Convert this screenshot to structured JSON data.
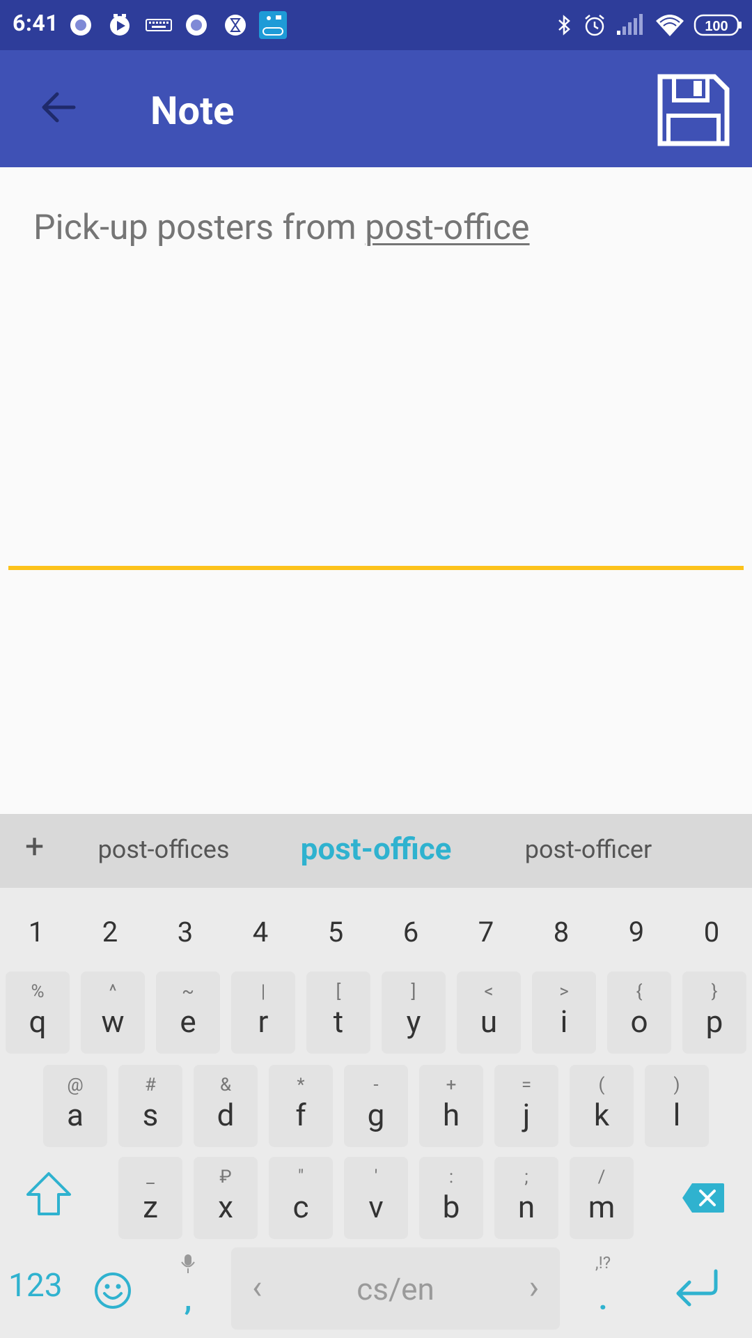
{
  "status_bar": {
    "time": "6:41",
    "battery": "100",
    "notification_icons": [
      "circle-notification-icon",
      "play-notification-icon",
      "keyboard-notification-icon",
      "circle-notification-icon",
      "hourglass-notification-icon",
      "fitness-app-notification-icon"
    ],
    "system_icons": [
      "bluetooth-icon",
      "alarm-icon",
      "signal-icon",
      "wifi-icon",
      "battery-icon"
    ]
  },
  "app_bar": {
    "title": "Note",
    "back_icon": "arrow-back-icon",
    "save_icon": "save-floppy-icon",
    "color": "#3f51b5",
    "status_color": "#2e3d9a"
  },
  "note": {
    "text_before": "Pick-up posters from ",
    "composing_word": "post-office",
    "underline_color": "#fcc21b"
  },
  "keyboard": {
    "suggestions": {
      "left": "post-offices",
      "center": "post-office",
      "right": "post-officer"
    },
    "number_row": [
      "1",
      "2",
      "3",
      "4",
      "5",
      "6",
      "7",
      "8",
      "9",
      "0"
    ],
    "row1": [
      {
        "key": "q",
        "alt": "%"
      },
      {
        "key": "w",
        "alt": "^"
      },
      {
        "key": "e",
        "alt": "~"
      },
      {
        "key": "r",
        "alt": "|"
      },
      {
        "key": "t",
        "alt": "["
      },
      {
        "key": "y",
        "alt": "]"
      },
      {
        "key": "u",
        "alt": "<"
      },
      {
        "key": "i",
        "alt": ">"
      },
      {
        "key": "o",
        "alt": "{"
      },
      {
        "key": "p",
        "alt": "}"
      }
    ],
    "row2": [
      {
        "key": "a",
        "alt": "@"
      },
      {
        "key": "s",
        "alt": "#"
      },
      {
        "key": "d",
        "alt": "&"
      },
      {
        "key": "f",
        "alt": "*"
      },
      {
        "key": "g",
        "alt": "-"
      },
      {
        "key": "h",
        "alt": "+"
      },
      {
        "key": "j",
        "alt": "="
      },
      {
        "key": "k",
        "alt": "("
      },
      {
        "key": "l",
        "alt": ")"
      }
    ],
    "row3": [
      {
        "key": "z",
        "alt": "_"
      },
      {
        "key": "x",
        "alt": "₽"
      },
      {
        "key": "c",
        "alt": "\""
      },
      {
        "key": "v",
        "alt": "'"
      },
      {
        "key": "b",
        "alt": ":"
      },
      {
        "key": "n",
        "alt": ";"
      },
      {
        "key": "m",
        "alt": "/"
      }
    ],
    "bottom": {
      "numbers_label": "123",
      "comma": ",",
      "space_label": "cs/en",
      "period": ".",
      "period_alt": ",!?"
    },
    "accent_color": "#2fb2cf"
  }
}
